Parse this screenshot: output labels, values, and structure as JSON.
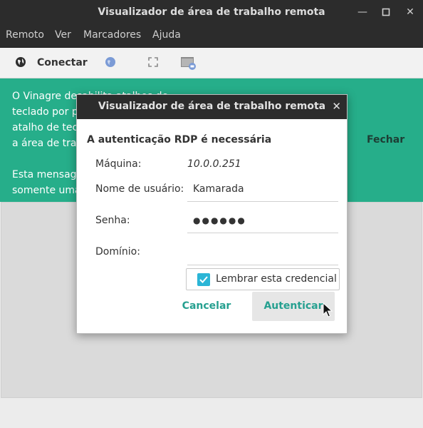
{
  "window": {
    "title": "Visualizador de área de trabalho remota",
    "controls": [
      "minimize-icon",
      "maximize-icon",
      "close-icon"
    ]
  },
  "menubar": {
    "items": [
      "Remoto",
      "Ver",
      "Marcadores",
      "Ajuda"
    ]
  },
  "toolbar": {
    "connect_label": "Conectar",
    "icons": [
      "globe-icon",
      "web-icon",
      "fullscreen-icon",
      "screenshot-icon"
    ]
  },
  "infobar": {
    "text": "O Vinagre desabilita atalhos de\nteclado por p\natalho de tecl\na área de trab\n\nEsta mensage\nsomente uma",
    "close_label": "Fechar"
  },
  "dialog": {
    "title": "Visualizador de área de trabalho remota",
    "heading": "A autenticação RDP é necessária",
    "host_label": "Máquina:",
    "host_value": "10.0.0.251",
    "username_label": "Nome de usuário:",
    "username_value": "Kamarada",
    "password_label": "Senha:",
    "password_value": "●●●●●●",
    "domain_label": "Domínio:",
    "domain_value": "",
    "remember_label": "Lembrar esta credencial",
    "remember_checked": true,
    "cancel_label": "Cancelar",
    "auth_label": "Autenticar"
  },
  "colors": {
    "titlebar": "#2c2c2c",
    "infobar": "#26ae8a",
    "accent": "#26a090",
    "checkbox": "#2bb5d6"
  }
}
